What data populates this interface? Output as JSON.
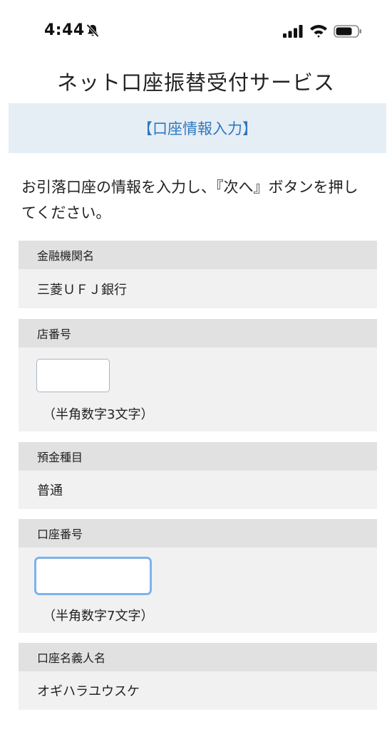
{
  "status_bar": {
    "time": "4:44",
    "icons": [
      "bell-slash-icon",
      "cellular-signal-icon",
      "wifi-icon",
      "battery-icon"
    ]
  },
  "page": {
    "title": "ネット口座振替受付サービス",
    "section_banner": "【口座情報入力】",
    "intro": "お引落口座の情報を入力し、『次へ』ボタンを押してください。"
  },
  "fields": {
    "bank": {
      "label": "金融機関名",
      "value": "三菱ＵＦＪ銀行"
    },
    "branch": {
      "label": "店番号",
      "value": "",
      "hint": "（半角数字3文字）"
    },
    "deposit_type": {
      "label": "預金種目",
      "value": "普通"
    },
    "account_number": {
      "label": "口座番号",
      "value": "",
      "hint": "（半角数字7文字）"
    },
    "holder": {
      "label": "口座名義人名",
      "value": "オギハラユウスケ"
    }
  },
  "colors": {
    "banner_bg": "#e6eef5",
    "banner_text": "#2e78c0",
    "field_label_bg": "#e1e1e1",
    "field_bg": "#f1f1f1",
    "focus_ring": "#7cb3ec"
  }
}
